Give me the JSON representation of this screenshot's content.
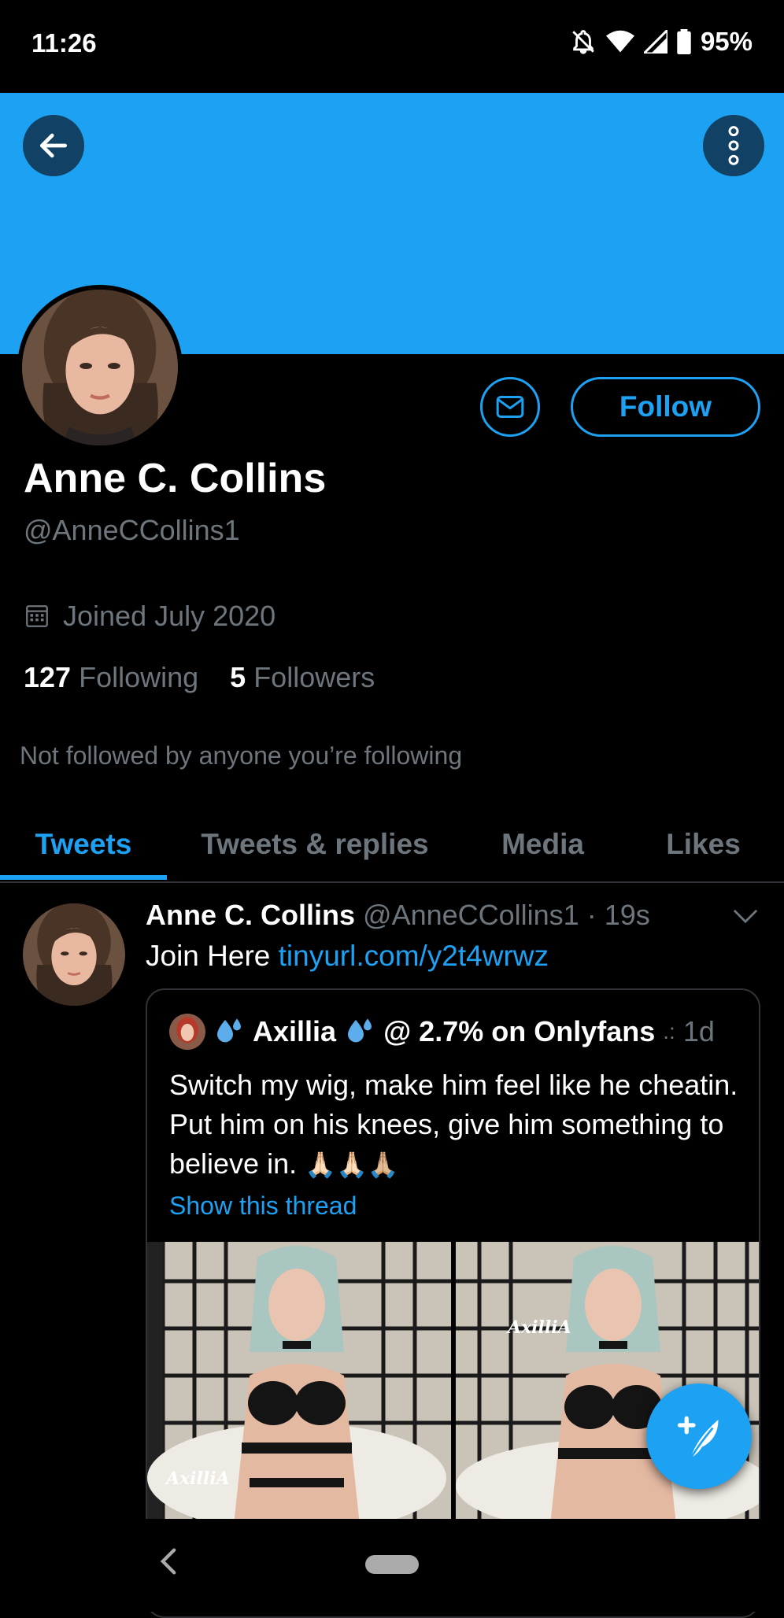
{
  "status_bar": {
    "time": "11:26",
    "battery": "95%",
    "icons": [
      "notifications-off-icon",
      "wifi-icon",
      "cell-signal-icon",
      "battery-icon"
    ]
  },
  "header": {
    "back_icon": "arrow-left-icon",
    "more_icon": "more-vertical-icon",
    "banner_color": "#1da1f2"
  },
  "profile": {
    "display_name": "Anne C. Collins",
    "handle": "@AnneCCollins1",
    "joined": "Joined July 2020",
    "following_count": "127",
    "following_label": "Following",
    "followers_count": "5",
    "followers_label": "Followers",
    "not_followed": "Not followed by anyone you’re following",
    "follow_button": "Follow",
    "message_icon": "envelope-icon"
  },
  "tabs": [
    {
      "label": "Tweets",
      "active": true
    },
    {
      "label": "Tweets & replies",
      "active": false
    },
    {
      "label": "Media",
      "active": false
    },
    {
      "label": "Likes",
      "active": false
    }
  ],
  "tweet": {
    "author": "Anne C. Collins",
    "handle": "@AnneCCollins1",
    "time": "19s",
    "text": "Join Here",
    "link": "tinyurl.com/y2t4wrwz",
    "quoted": {
      "name": "Axillia",
      "suffix": "@ 2.7% on Onlyfans",
      "time": "1d",
      "text": "Switch my wig, make him feel like he cheatin. Put him on his knees, give him something to believe in.",
      "emoji": "🙏🏻🙏🏻🙏🏼",
      "show_thread": "Show this thread",
      "watermark": "AxilliA"
    }
  },
  "accent_color": "#1da1f2"
}
